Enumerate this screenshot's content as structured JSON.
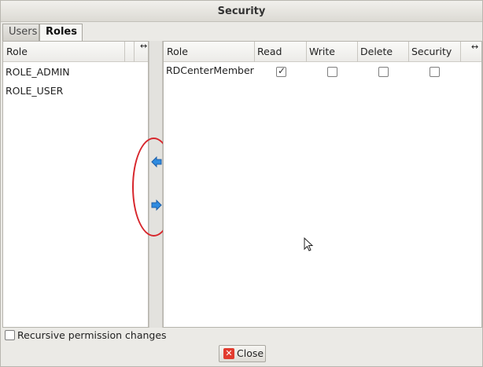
{
  "dialog": {
    "title": "Security"
  },
  "tabs": [
    {
      "label": "Users",
      "active": false
    },
    {
      "label": "Roles",
      "active": true
    }
  ],
  "left_panel": {
    "column_header": "Role",
    "rows": [
      "ROLE_ADMIN",
      "ROLE_USER"
    ]
  },
  "right_panel": {
    "columns": [
      "Role",
      "Read",
      "Write",
      "Delete",
      "Security"
    ],
    "rows": [
      {
        "role": "RDCenterMember",
        "read": true,
        "write": false,
        "delete": false,
        "security": false
      }
    ]
  },
  "footer": {
    "recursive_label": "Recursive permission changes",
    "recursive_checked": false,
    "close_label": "Close"
  },
  "colors": {
    "arrow_blue": "#2f8be0",
    "highlight_red": "#d7262c",
    "close_icon_red": "#e23b2e"
  },
  "icons": [
    "resize-horizontal-icon",
    "arrow-left-icon",
    "arrow-right-icon",
    "close-icon",
    "mouse-cursor-icon"
  ]
}
